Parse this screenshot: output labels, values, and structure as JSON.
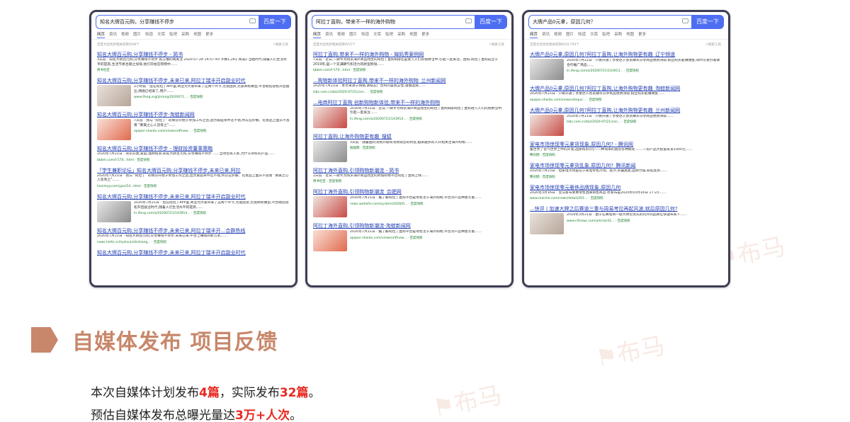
{
  "search_panels": [
    {
      "query": "知名大牌百元购，分享赚钱不停步",
      "button": "百度一下",
      "results": [
        {
          "title": "知名大牌百元购,分享赚钱不停步 - 简书",
          "snippet": "3天前 · 知名大牌百元购,分享赚钱不停步 张方维的网关注 2020.07.28 14:57:43 字数1,261 阅读2 当粗时代,随着人们生活水平的提高,生活节奏也随之加快,他们开始在购物中……",
          "source": "简书社区"
        },
        {
          "title": "知名大牌百元购,分享赚钱不停步,未来已来,阿拉丁瑞丰开启副业时代",
          "snippet": "2小时前 · 但在阿拉丁APP里,商业为大家带来了这两个环节,无需囤货,无需商标做垫,平台助您轻松开启副业,网络已经来了,用户……",
          "source": "www.ifeng.org/jinrong/2020071... · 百度快照"
        },
        {
          "title": "知名大牌百元购,分享赚钱不停步-淘蛙新闻网",
          "snippet": "7天前 · 我与 \"阿拉丁\" 的缘分开始于参加工作之后,因为家庭条件还不错,所以在护肤、化妆品上面从不吝啬 \"要美之心人皆有之\"……",
          "source": "epaper.nhaidu.com/xinwen/dfnew... · 百度快照"
        },
        {
          "title": "知名大牌百元购,分享赚钱不停步 - 理财投资董事策略",
          "snippet": "2020年7月21日 · 资讯分类,家庭,理财投资,知名大牌百元购,分享赚钱不停步 ……当然也有人民,为什么带好的产品……",
          "source": "bbbm.com/t-570...html · 百度快照"
        },
        {
          "title": "「学生兼职论坛」知名大牌百元购,分享赚钱不停步,未来已来,阿拉",
          "snippet": "2020年7月21日 · 我与 \"阿拉丁\" 的缘分开始于参加工作之后,因为家庭条件还不错,所以在护肤、化妆品上面从不吝啬 \"要美之心人皆有之\"……",
          "source": "hxzrmyy.com/yjzs/54...html · 百度快照"
        },
        {
          "title": "知名大牌百元购,分享赚钱不停步,未来已来,阿拉丁瑞丰开启副业时代",
          "snippet": "2020年7月21日 · 但在阿拉丁APP里,商业为大家带来了这两个环节,无需囤货,无需商标做垫,平台助您轻松开启副业时代,随着人们生活水平的提高……",
          "source": "ln.ifeng.com/a/20200721/143914... · 百度快照"
        },
        {
          "title": "知名大牌百元购,分享赚钱不停步,未来已来,阿拉丁瑞丰开...合群热线",
          "snippet": "2020年7月21日 · 知名大牌百元购,分享赚钱不停步,未来已来,平台上赚钱的新方式……",
          "source": "news.hefei.cc/hyzixun/shishang... · 百度快照"
        },
        {
          "title": "知名大牌百元购,分享赚钱不停步,未来已来,阿拉丁瑞丰开启副业时代",
          "snippet": "",
          "source": ""
        }
      ]
    },
    {
      "query": "阿拉丁直购，带来不一样的海外购物",
      "button": "百度一下",
      "results": [
        {
          "title": "阿拉丁直购,带来不一样的海外购物 - 婵妈秀案例网",
          "snippet": "7天前 · 近日,一款专为购买海外商品而生的阿拉丁直购app还是进入人们的视野当中,引起一度关注。直购,阿拉丁直购成立于2019年,是一个充满朝气和活力的新型跨境……",
          "source": "bbbm.com/t-570...html · 百度快照"
        },
        {
          "title": "...购物新体验阿拉丁直购,带来不一样的海外购物_兰州新闻网",
          "snippet": "2020年7月21日 · 本文来源于网络,请核实广告和内容真实性,谨慎选择……",
          "source": "lzbs.com.cn/biz/2020-07/21/con... · 百度快照"
        },
        {
          "title": "...电商阿拉丁直购 创新购物新体验,带来不一样的海外购物",
          "snippet": "2020年7月21日 · 近日,一款专为购买海外商品而生的阿拉丁直购app阿拉丁直购进入人们的视野当中,引起一度关注……",
          "source": "ln.ifeng.com/a/20200721/143914... · 百度快照"
        },
        {
          "title": "阿拉丁直购,让海外购物更有趣_搜狐",
          "snippet": "3天前 · 随着国内消费升级和消费观念的转变,越来越多的人开始关注海外购物……",
          "source": "搜狐网 · 百度快照"
        },
        {
          "title": "阿拉丁海外直购,引领购物新潮流 - 简书",
          "snippet": "2天前 · 近日,一款专为购买海外商品而生的跨境购物平台阿拉丁直购上线……",
          "source": "简书社区 · 百度快照"
        },
        {
          "title": "阿拉丁海外直购,引领购物新潮流_合肥网",
          "snippet": "2020年7月21日 · 据了解阿拉丁直购平台是零售注于海外购物,平台对产品种类丰富……",
          "source": "news.wehefei.com/system/2020/0... · 百度快照"
        },
        {
          "title": "阿拉丁海外直购,引领购物新潮流-淘蛙新闻网",
          "snippet": "2020年7月21日 · 据了解阿拉丁直购平台是零售注于海外购物,平台对产品种类丰富……",
          "source": "epaper.nhaidu.com/xinwen/dfnew... · 百度快照"
        }
      ]
    },
    {
      "query": "大牌产品0元拿，原因几何？",
      "button": "百度一下",
      "results": [
        {
          "title": "大牌产品0元拿,原因几何?阿拉丁直购,让海外购物更有趣_辽宁频道",
          "snippet": "2020年7月21日 · 只要开通了享受达人会员赚华分享商品免费领取,粉丝购买能赚佣金,同时可发付邀请合作推广商品……",
          "source": "ln.ifeng.com/a/20200721/143913... · 百度快照"
        },
        {
          "title": "大牌产品0元拿,原因几何?阿拉丁直购,让海外购物更有趣_淘蛙新闻网",
          "snippet": "2020年7月21日 · 只要开通了享受达人会员赚华分享商品免费领取,粉丝购买能赚佣金……",
          "source": "epaper.nhaidu.com/xinwen/kepu/... · 百度快照"
        },
        {
          "title": "大牌产品0元拿,原因几何?阿拉丁直购,让海外购物更有趣_兰州新闻网",
          "snippet": "2020年7月21日 · 只要开通了享受达人会员赚华分享商品免费领取……",
          "source": "lzbs.com.cn/biz/2020-07/21/con... · 百度快照"
        },
        {
          "title": "家电市场惊现零元拿货现象,原因几何? - 腾讯网",
          "snippet": "集世界了名气世界上中的开发,选择购买0元一一种简单的厨房多种模式 ……一份产品大批量拿货1000元……",
          "source": "腾讯网 · 百度快照"
        },
        {
          "title": "家电市场惊现零元拿货乱象,原因几何?_腾讯新闻",
          "snippet": "2020年7月23日 · 但家电市场是在于家电零售冷场。其外,多器具类,品牌力强,知名度高……",
          "source": "腾讯网 · 百度快照"
        },
        {
          "title": "家电市场惊现零元奢侈品牌现象,原因几何",
          "snippet": "2020年3月16日 · 宝马发布受惠零售直降销售商品 原发布是2020年03月16日 17:23……",
          "source": "www.maiche.com/news/detail/201... · 百度快照"
        },
        {
          "title": "...快评 | 加速大牌之后赛道三重与周易考拉再起风波,就后原因几何?",
          "snippet": "2019年3月21日 · 由于在赛电商一级大牌化优先的内外的品牌在快速布局下……",
          "source": "www.cifnews.com/article/42... · 百度快照"
        }
      ]
    }
  ],
  "section": {
    "title": "自媒体发布 项目反馈"
  },
  "summary": {
    "line1": {
      "prefix": "本次自媒体计划发布",
      "plan": "4篇",
      "mid": "，实际发布",
      "actual": "32篇",
      "suffix": "。"
    },
    "line2": {
      "prefix": "预估自媒体发布总曝光量达",
      "value": "3万+人次",
      "suffix": "。"
    }
  },
  "colors": {
    "accent": "#c8876a",
    "highlight": "#e8281f",
    "baidu_blue": "#4e6ef2",
    "link": "#2440b3",
    "source_green": "#1a7f2b"
  }
}
